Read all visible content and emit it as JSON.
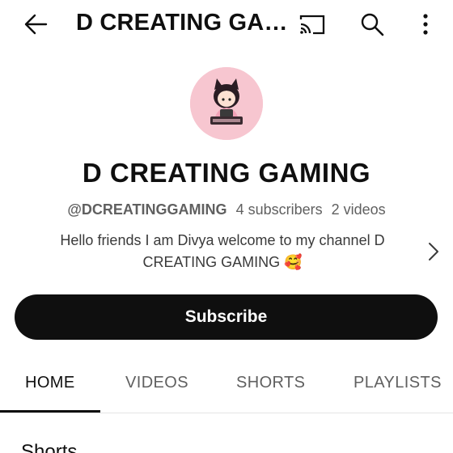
{
  "topbar": {
    "title": "D CREATING GA…",
    "back_icon": "back-arrow-icon",
    "cast_icon": "cast-icon",
    "search_icon": "search-icon",
    "more_icon": "more-vert-icon"
  },
  "channel": {
    "name": "D CREATING GAMING",
    "handle": "@DCREATINGGAMING",
    "subscribers": "4 subscribers",
    "videos": "2 videos",
    "description": "Hello friends I am Divya welcome to my channel D CREATING GAMING 🥰",
    "avatar_icon": "channel-avatar",
    "avatar_color": "#f7c6d0"
  },
  "subscribe_label": "Subscribe",
  "tabs": [
    {
      "label": "HOME",
      "active": true
    },
    {
      "label": "VIDEOS",
      "active": false
    },
    {
      "label": "SHORTS",
      "active": false
    },
    {
      "label": "PLAYLISTS",
      "active": false
    }
  ],
  "section_title": "Shorts"
}
